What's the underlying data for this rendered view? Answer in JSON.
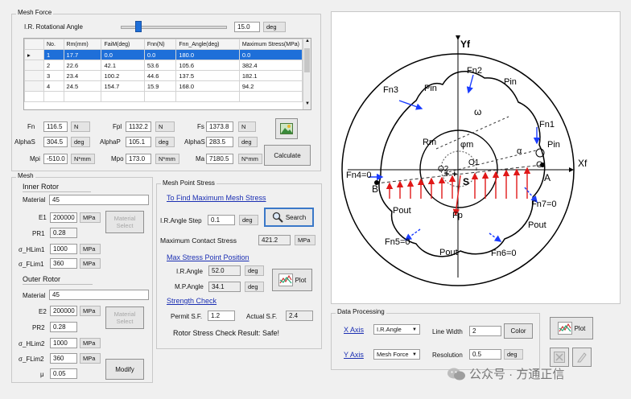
{
  "mesh_force": {
    "title": "Mesh Force",
    "ir_angle_label": "I.R. Rotational Angle",
    "ir_angle_value": "15.0",
    "ir_angle_unit": "deg",
    "slider_fraction": 0.14,
    "table": {
      "headers": [
        "No.",
        "Rm(mm)",
        "FaiM(deg)",
        "Fnn(N)",
        "Fnn_Angle(deg)",
        "Maximum Stress(MPa)"
      ],
      "rows": [
        [
          "1",
          "17.7",
          "0.0",
          "0.0",
          "180.0",
          "0.0"
        ],
        [
          "2",
          "22.6",
          "42.1",
          "53.6",
          "105.6",
          "382.4"
        ],
        [
          "3",
          "23.4",
          "100.2",
          "44.6",
          "137.5",
          "182.1"
        ],
        [
          "4",
          "24.5",
          "154.7",
          "15.9",
          "168.0",
          "94.2"
        ]
      ],
      "selected_row": 0
    },
    "fn_label": "Fn",
    "fn_value": "116.5",
    "fn_unit": "N",
    "fpl_label": "Fpl",
    "fpl_value": "1132.2",
    "fpl_unit": "N",
    "fs_label": "Fs",
    "fs_value": "1373.8",
    "fs_unit": "N",
    "alpha_label": "AlphaS",
    "alpha_value": "304.5",
    "alpha_unit": "deg",
    "alphap_label": "AlphaP",
    "alphap_value": "105.1",
    "alphap_unit": "deg",
    "alphans_label": "AlphaS",
    "alphans_value": "283.5",
    "alphans_unit": "deg",
    "mpi_label": "Mpi",
    "mpi_value": "-510.0",
    "mpi_unit": "N*mm",
    "mpo_label": "Mpo",
    "mpo_value": "173.0",
    "mpo_unit": "N*mm",
    "ma_label": "Ma",
    "ma_value": "7180.5",
    "ma_unit": "N*mm",
    "calculate_label": "Calculate"
  },
  "mesh": {
    "title": "Mesh",
    "inner_rotor": {
      "title": "Inner Rotor",
      "material_label": "Material",
      "material_value": "45",
      "e1_label": "E1",
      "e1_value": "200000",
      "e1_unit": "MPa",
      "pr1_label": "PR1",
      "pr1_value": "0.28",
      "sh1_label": "σ_HLim1",
      "sh1_value": "1000",
      "sh1_unit": "MPa",
      "sf1_label": "σ_FLim1",
      "sf1_value": "360",
      "sf1_unit": "MPa",
      "material_select": "Material Select"
    },
    "outer_rotor": {
      "title": "Outer Rotor",
      "material_label": "Material",
      "material_value": "45",
      "e2_label": "E2",
      "e2_value": "200000",
      "e2_unit": "MPa",
      "pr2_label": "PR2",
      "pr2_value": "0.28",
      "sh2_label": "σ_HLim2",
      "sh2_value": "1000",
      "sh2_unit": "MPa",
      "sf2_label": "σ_FLim2",
      "sf2_value": "360",
      "sf2_unit": "MPa",
      "mu_label": "μ",
      "mu_value": "0.05",
      "material_select": "Material Select"
    },
    "modify_label": "Modify"
  },
  "mesh_point_stress": {
    "title": "Mesh Point Stress",
    "find_max_link": "To Find Maximum Mesh Stress",
    "ir_step_label": "I.R.Angle Step",
    "ir_step_value": "0.1",
    "ir_step_unit": "deg",
    "search_label": "Search",
    "max_contact_label": "Maximum Contact Stress",
    "max_contact_value": "421.2",
    "max_contact_unit": "MPa",
    "max_pos_link": "Max Stress Point Position",
    "ir_angle_label": "I.R.Angle",
    "ir_angle_value": "52.0",
    "ir_angle_unit": "deg",
    "mp_angle_label": "M.P.Angle",
    "mp_angle_value": "34.1",
    "mp_angle_unit": "deg",
    "plot_label": "Plot",
    "strength_link": "Strength Check",
    "permit_label": "Permit S.F.",
    "permit_value": "1.2",
    "actual_label": "Actual S.F.",
    "actual_value": "2.4",
    "result_text": "Rotor Stress Check Result: Safe!"
  },
  "data_processing": {
    "title": "Data Processing",
    "x_axis_label": "X Axis",
    "x_axis_value": "I.R.Angle",
    "y_axis_label": "Y Axis",
    "y_axis_value": "Mesh Force",
    "line_width_label": "Line Width",
    "line_width_value": "2",
    "color_label": "Color",
    "resolution_label": "Resolution",
    "resolution_value": "0.5",
    "resolution_unit": "deg",
    "plot_label": "Plot"
  },
  "diagram_labels": {
    "yf": "Yf",
    "xf": "Xf",
    "fn2": "Fn2",
    "fn3": "Fn3",
    "fn1": "Fn1",
    "pin_a": "Pin",
    "pin_b": "Pin",
    "pin_c": "Pin",
    "omega": "ω",
    "rm": "Rm",
    "phim": "φm",
    "alpha": "α",
    "fn4": "Fn4=0",
    "fn5": "Fn5=0",
    "fn6": "Fn6=0",
    "fn7": "Fn7=0",
    "o2": "O2",
    "o1": "O1",
    "s": "S",
    "fp": "Fp",
    "a": "A",
    "b": "B",
    "c": "C",
    "pout_a": "Pout",
    "pout_b": "Pout",
    "pout_c": "Pout"
  },
  "watermark": "公众号 · 方通正信"
}
